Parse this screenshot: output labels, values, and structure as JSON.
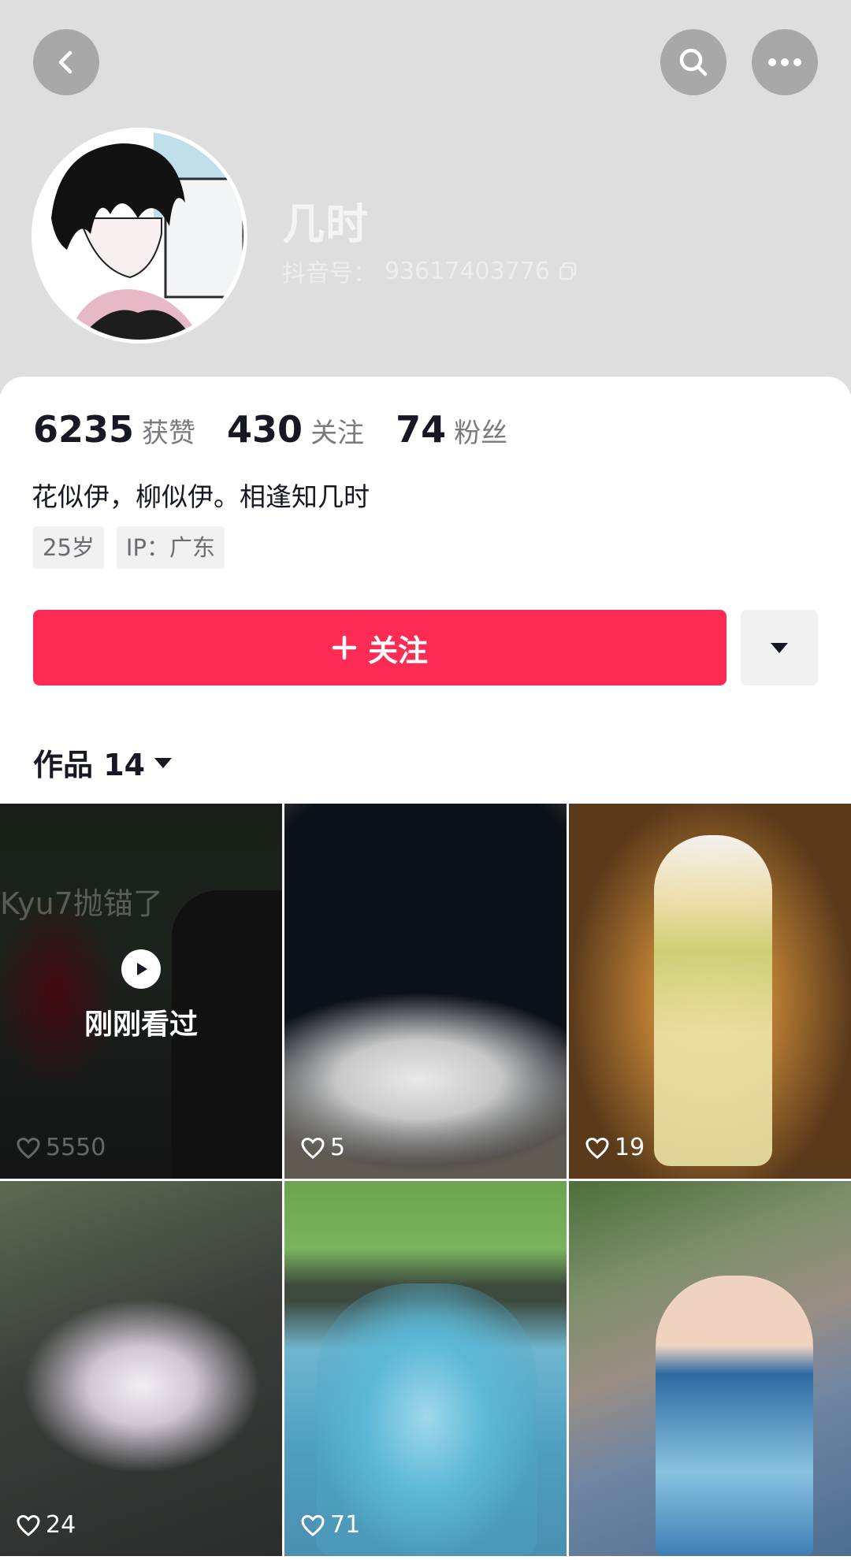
{
  "profile": {
    "nickname": "几时",
    "douyin_id_label": "抖音号：",
    "douyin_id": "93617403776"
  },
  "stats": [
    {
      "value": "6235",
      "label": "获赞"
    },
    {
      "value": "430",
      "label": "关注"
    },
    {
      "value": "74",
      "label": "粉丝"
    }
  ],
  "bio": "花似伊，柳似伊。相逢知几时",
  "tags": [
    "25岁",
    "IP：广东"
  ],
  "actions": {
    "follow_label": "关注"
  },
  "works": {
    "label": "作品 14"
  },
  "videos": [
    {
      "likes": "5550",
      "overlay_text": "刚刚看过",
      "caption": "Kyu7抛锚了"
    },
    {
      "likes": "5"
    },
    {
      "likes": "19"
    },
    {
      "likes": "24"
    },
    {
      "likes": "71"
    },
    {
      "likes": ""
    }
  ],
  "colors": {
    "accent": "#fe2c55",
    "header_bg": "#dedede"
  },
  "icons": [
    "back-arrow-icon",
    "search-icon",
    "more-icon",
    "copy-icon",
    "plus-icon",
    "caret-down-icon",
    "heart-icon",
    "play-icon"
  ]
}
